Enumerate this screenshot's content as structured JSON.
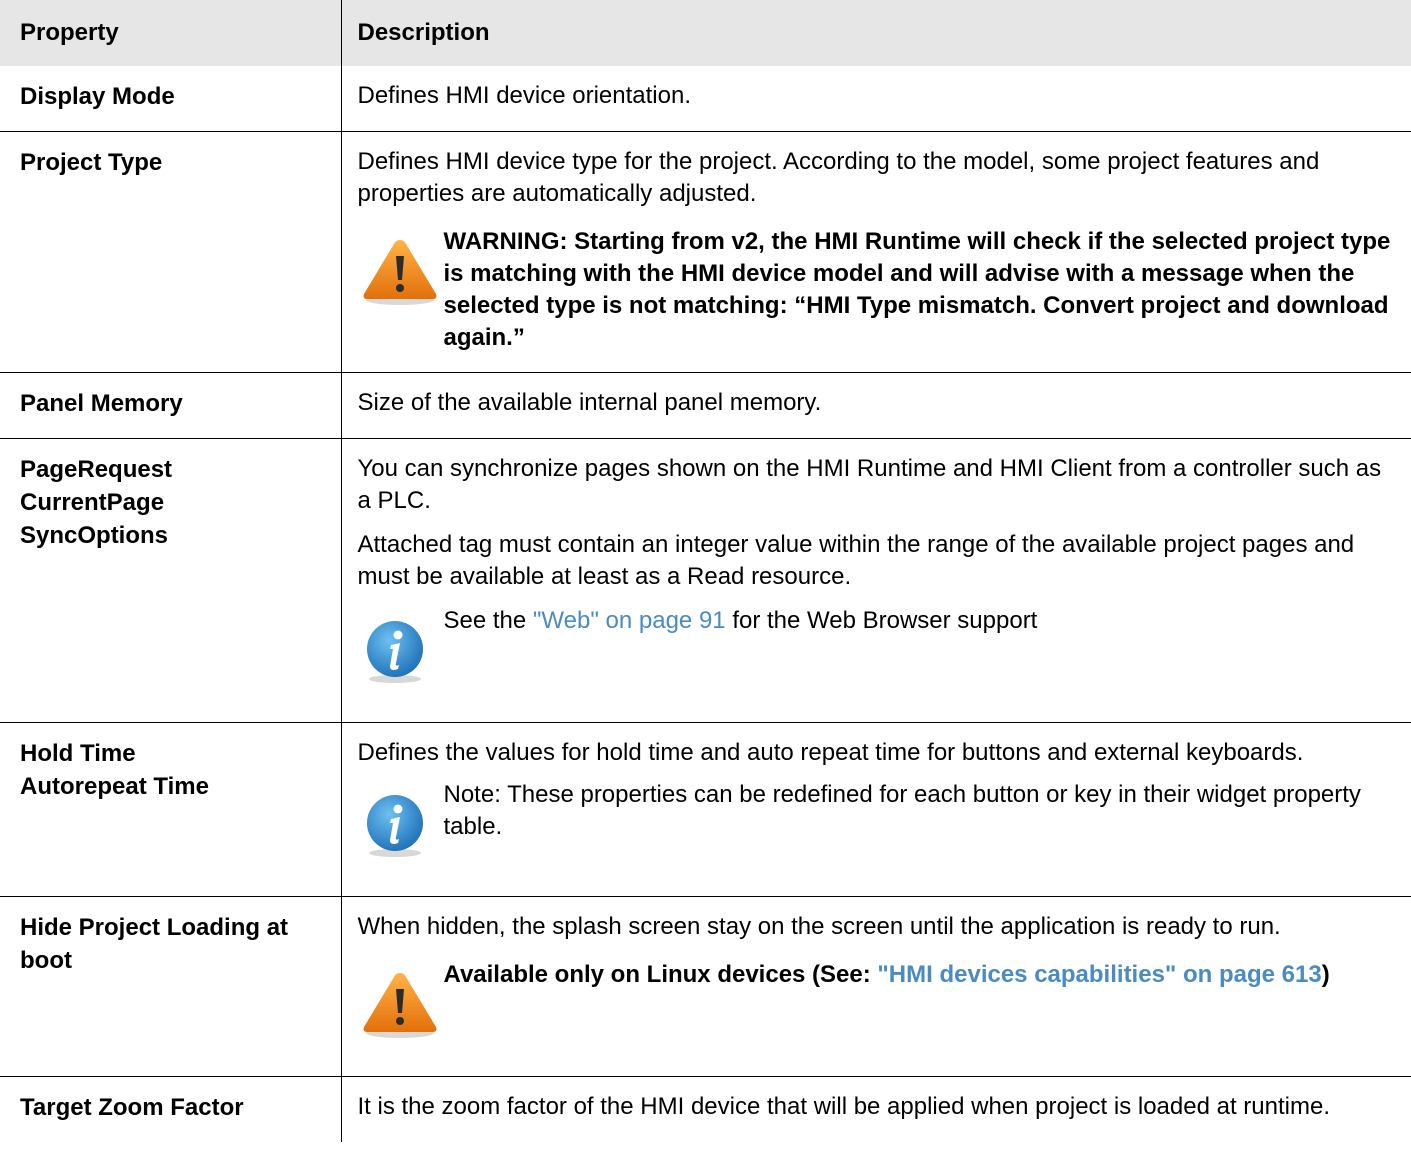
{
  "columns": {
    "property": "Property",
    "description": "Description"
  },
  "rows": {
    "display_mode": {
      "prop": "Display Mode",
      "desc": "Defines HMI device orientation."
    },
    "project_type": {
      "prop": "Project Type",
      "desc": "Defines HMI device type for the project. According to the model, some project features and properties are automatically adjusted.",
      "warning": "WARNING: Starting from v2, the HMI Runtime will check if the selected project type is matching with the HMI device model and will advise with a message when the selected type is not matching: “HMI Type mismatch. Convert project and download again.”"
    },
    "panel_memory": {
      "prop": "Panel Memory",
      "desc": "Size of the available internal panel memory."
    },
    "page_sync": {
      "prop_lines": [
        "PageRequest",
        "CurrentPage",
        "SyncOptions"
      ],
      "desc1": "You can synchronize pages shown on the HMI Runtime and HMI Client from a controller such as a PLC.",
      "desc2": "Attached tag must contain an integer value within the range of the available project pages and must be available at least as a Read resource.",
      "info_prefix": "See the ",
      "info_link": "\"Web\" on page 91",
      "info_suffix": " for the Web Browser support"
    },
    "hold_time": {
      "prop_lines": [
        "Hold Time",
        "Autorepeat Time"
      ],
      "desc": "Defines the values for hold time and auto repeat time for buttons and external keyboards.",
      "note": "Note: These properties can be redefined for each button or key in their widget property table."
    },
    "hide_loading": {
      "prop": "Hide Project Loading at boot",
      "desc": "When hidden, the splash screen stay on the screen until the application is ready to run.",
      "warn_prefix": "Available only on Linux devices (See: ",
      "warn_link": "\"HMI devices capabilities\" on page 613",
      "warn_suffix": ")"
    },
    "zoom_factor": {
      "prop": "Target Zoom Factor",
      "desc": "It is the zoom factor of the HMI device that will be applied when project is loaded at runtime."
    }
  },
  "icons": {
    "warning": "warning-icon",
    "info": "info-icon"
  },
  "colors": {
    "header_bg": "#e6e6e6",
    "link": "#4a8bc4",
    "warning_orange": "#f08a12",
    "info_blue": "#2a8ad0"
  }
}
